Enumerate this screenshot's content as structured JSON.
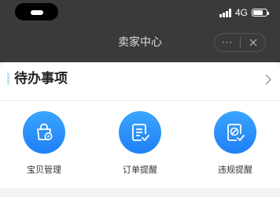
{
  "status_bar": {
    "network": "4G",
    "battery_level": 0.75
  },
  "nav": {
    "title": "卖家中心",
    "more_label": "···"
  },
  "section": {
    "title": "待办事项",
    "items": [
      {
        "label": "宝贝管理",
        "icon": "bag-gear-icon"
      },
      {
        "label": "订单提醒",
        "icon": "document-check-icon"
      },
      {
        "label": "违规提醒",
        "icon": "forbidden-doc-icon"
      }
    ]
  },
  "colors": {
    "icon_gradient_top": "#3aa5ff",
    "icon_gradient_bottom": "#1f7ff5",
    "accent_bar": "#bfe6f3",
    "header_bg": "#3a3a3a"
  }
}
